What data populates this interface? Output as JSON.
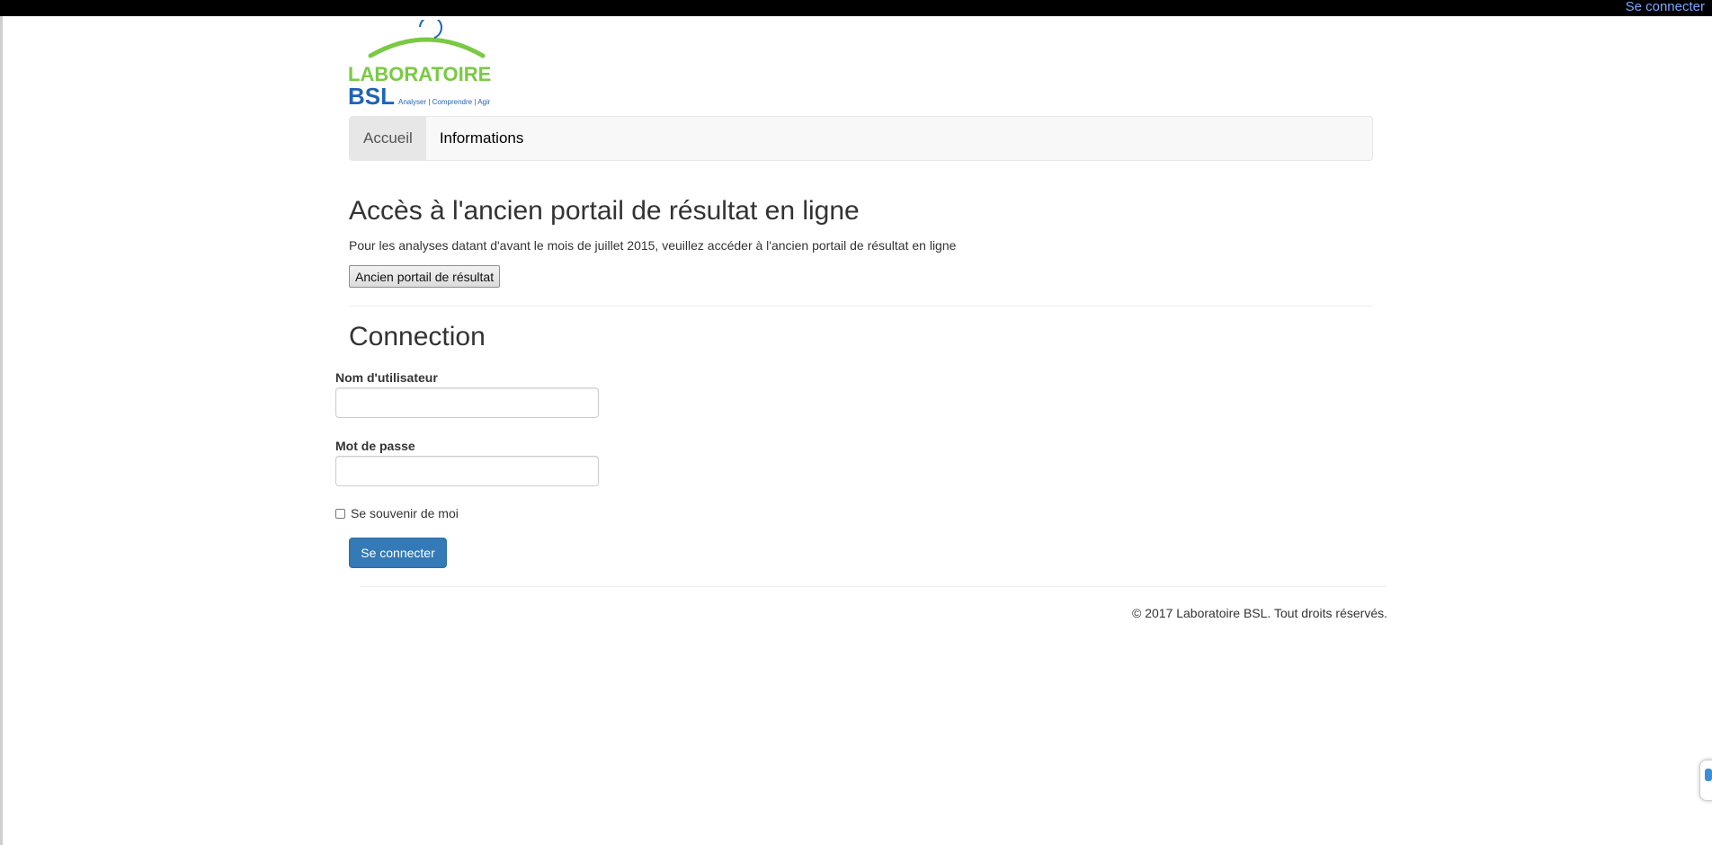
{
  "topbar": {
    "login_link": "Se connecter"
  },
  "logo": {
    "line1": "LABORATOIRE",
    "line2": "BSL",
    "tagline": "Analyser | Comprendre | Agir",
    "colors": {
      "green": "#7ac943",
      "blue": "#1f63b5"
    }
  },
  "nav": {
    "items": [
      {
        "label": "Accueil",
        "active": true
      },
      {
        "label": "Informations",
        "active": false
      }
    ]
  },
  "old_portal": {
    "heading": "Accès à l'ancien portail de résultat en ligne",
    "text": "Pour les analyses datant d'avant le mois de juillet 2015, veuillez accéder à l'ancien portail de résultat en ligne",
    "button_label": "Ancien portail de résultat"
  },
  "login": {
    "heading": "Connection",
    "username_label": "Nom d'utilisateur",
    "username_value": "",
    "password_label": "Mot de passe",
    "password_value": "",
    "remember_label": "Se souvenir de moi",
    "remember_checked": false,
    "submit_label": "Se connecter"
  },
  "footer": {
    "text": "© 2017 Laboratoire BSL. Tout droits réservés."
  },
  "colors": {
    "primary": "#337ab7",
    "topbar": "#000000",
    "link": "#7ea6ff"
  }
}
